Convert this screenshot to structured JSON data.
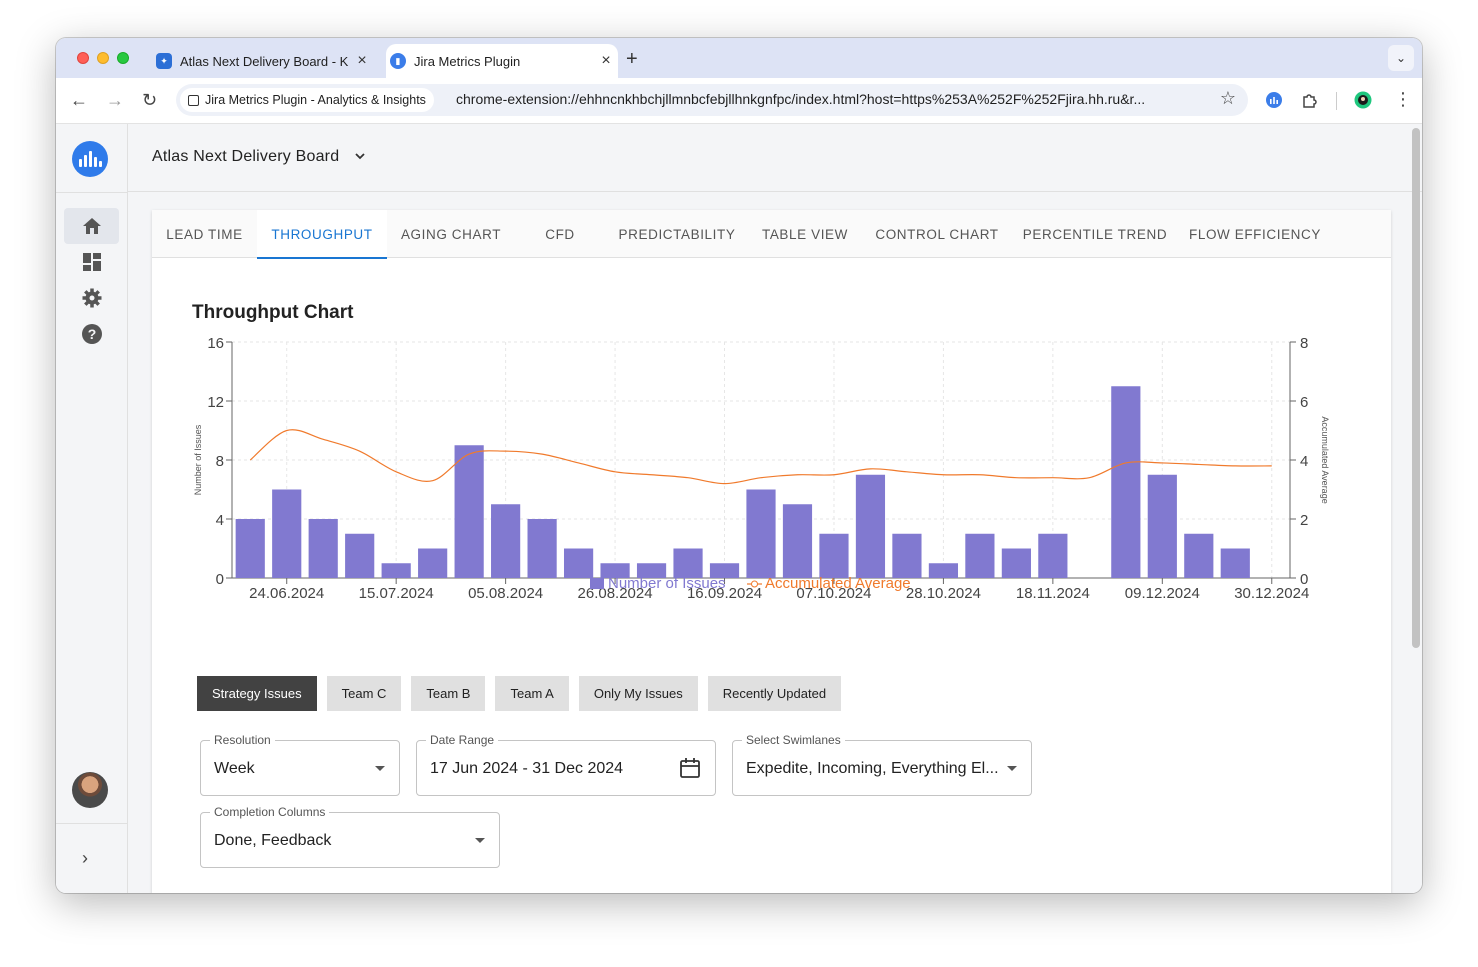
{
  "browser": {
    "tabs": [
      {
        "title": "Atlas Next Delivery Board - K",
        "active": false
      },
      {
        "title": "Jira Metrics Plugin",
        "active": true
      }
    ],
    "site_chip": "Jira Metrics Plugin - Analytics & Insights",
    "url": "chrome-extension://ehhncnkhbchjllmnbcfebjllhnkgnfpc/index.html?host=https%253A%252F%252Fjira.hh.ru&r..."
  },
  "app": {
    "board_title": "Atlas Next Delivery Board",
    "tabs": [
      "LEAD TIME",
      "THROUGHPUT",
      "AGING CHART",
      "CFD",
      "PREDICTABILITY",
      "TABLE VIEW",
      "CONTROL CHART",
      "PERCENTILE TREND",
      "FLOW EFFICIENCY"
    ],
    "active_tab": "THROUGHPUT",
    "chart_title": "Throughput Chart",
    "filters": [
      "Strategy Issues",
      "Team C",
      "Team B",
      "Team A",
      "Only My Issues",
      "Recently Updated"
    ],
    "active_filter": "Strategy Issues",
    "fields": {
      "resolution": {
        "label": "Resolution",
        "value": "Week"
      },
      "date_range": {
        "label": "Date Range",
        "value": "17 Jun 2024 - 31 Dec 2024"
      },
      "swimlanes": {
        "label": "Select Swimlanes",
        "value": "Expedite, Incoming, Everything El..."
      },
      "completion": {
        "label": "Completion Columns",
        "value": "Done, Feedback"
      }
    }
  },
  "colors": {
    "bar": "#8179d0",
    "line": "#f07a2c",
    "accent": "#1976d2"
  },
  "chart_data": {
    "type": "bar",
    "title": "Throughput Chart",
    "ylabel": "Number of Issues",
    "y2label": "Accumulated Average",
    "ylim": [
      0,
      16
    ],
    "y2lim": [
      0,
      8
    ],
    "yticks": [
      0,
      4,
      8,
      12,
      16
    ],
    "y2ticks": [
      0,
      2,
      4,
      6,
      8
    ],
    "xtick_labels": [
      "24.06.2024",
      "15.07.2024",
      "05.08.2024",
      "26.08.2024",
      "16.09.2024",
      "07.10.2024",
      "28.10.2024",
      "18.11.2024",
      "09.12.2024",
      "30.12.2024"
    ],
    "series": [
      {
        "name": "Number of Issues",
        "type": "bar",
        "values": [
          4,
          6,
          4,
          3,
          1,
          2,
          9,
          5,
          4,
          2,
          1,
          1,
          2,
          1,
          6,
          5,
          3,
          7,
          3,
          1,
          3,
          2,
          3,
          0,
          13,
          7,
          3,
          2,
          0
        ]
      },
      {
        "name": "Accumulated Average",
        "type": "line",
        "axis": "right",
        "values": [
          4.0,
          5.0,
          4.7,
          4.3,
          3.6,
          3.3,
          4.2,
          4.3,
          4.2,
          3.9,
          3.6,
          3.5,
          3.4,
          3.2,
          3.4,
          3.5,
          3.5,
          3.7,
          3.6,
          3.5,
          3.5,
          3.4,
          3.4,
          3.4,
          3.9,
          3.9,
          3.85,
          3.8,
          3.8
        ]
      }
    ],
    "legend": "bottom-center",
    "grid": true
  }
}
